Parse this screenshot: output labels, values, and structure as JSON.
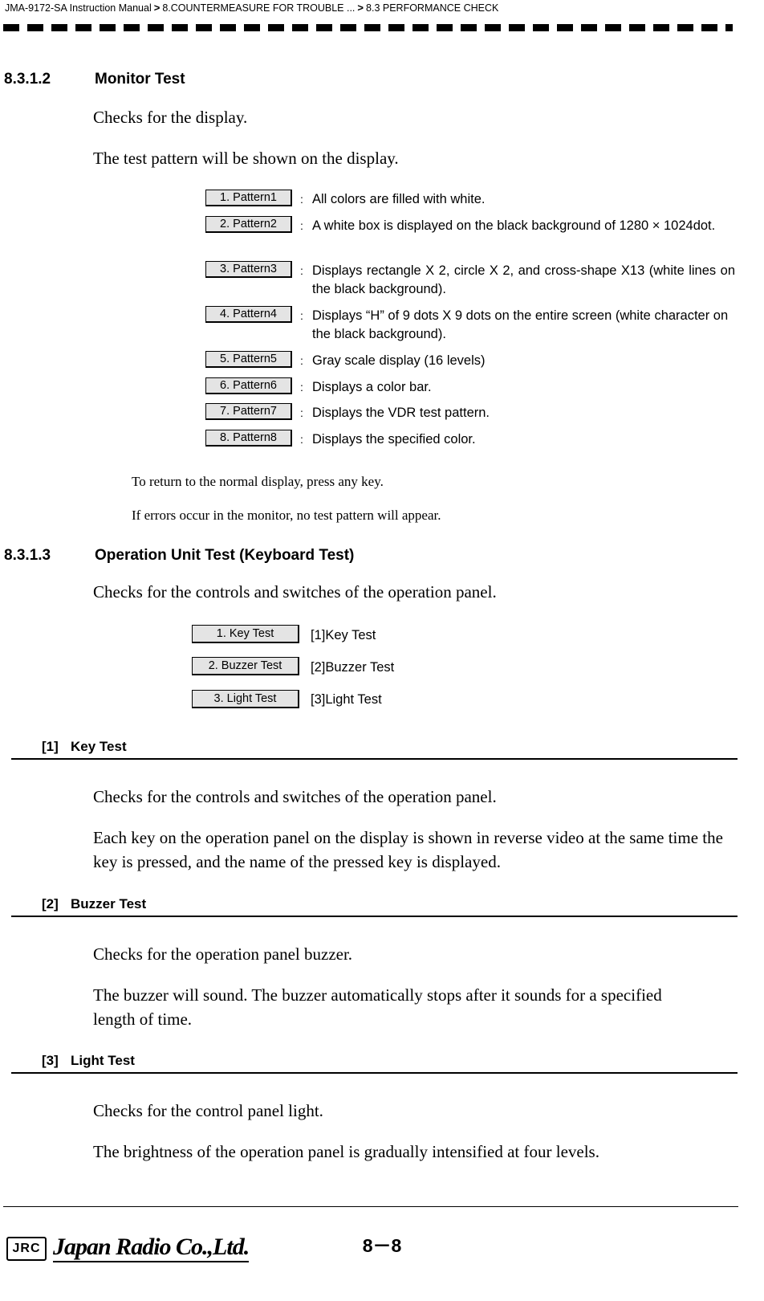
{
  "header": {
    "manual": "JMA-9172-SA Instruction Manual",
    "sep1": ">",
    "crumb1": "8.COUNTERMEASURE FOR TROUBLE ...",
    "sep2": ">",
    "crumb2": "8.3  PERFORMANCE CHECK"
  },
  "monitor_section": {
    "number": "8.3.1.2",
    "title": "Monitor Test",
    "line1": "Checks for the display.",
    "line2": "The test pattern will be shown on the display.",
    "patterns": [
      {
        "chip": "1. Pattern1",
        "colon": ":",
        "desc": "All colors are filled with white."
      },
      {
        "chip": "2. Pattern2",
        "colon": ":",
        "desc": "A white box is displayed on the black background of 1280 × 1024dot."
      },
      {
        "chip": "3. Pattern3",
        "colon": ":",
        "desc": "Displays rectangle X 2, circle X 2, and cross-shape X13 (white lines on the black background)."
      },
      {
        "chip": "4. Pattern4",
        "colon": ":",
        "desc": "Displays “H” of 9 dots X 9 dots on the entire screen (white character on the black background)."
      },
      {
        "chip": "5. Pattern5",
        "colon": ":",
        "desc": "Gray scale display (16 levels)"
      },
      {
        "chip": "6. Pattern6",
        "colon": ":",
        "desc": "Displays a color bar."
      },
      {
        "chip": "7. Pattern7",
        "colon": ":",
        "desc": "Displays the VDR test pattern."
      },
      {
        "chip": "8. Pattern8",
        "colon": ":",
        "desc": "Displays the specified color."
      }
    ],
    "note1": "To return to the normal display, press any key.",
    "note2": "If errors occur in the monitor, no test pattern will appear."
  },
  "operation_section": {
    "number": "8.3.1.3",
    "title": "Operation Unit Test  (Keyboard Test)",
    "line1": "Checks for the controls and switches of the operation panel.",
    "items": [
      {
        "chip": "1. Key Test",
        "label": "[1]Key Test"
      },
      {
        "chip": "2. Buzzer Test",
        "label": "[2]Buzzer Test"
      },
      {
        "chip": "3. Light Test",
        "label": "[3]Light Test"
      }
    ]
  },
  "subsections": [
    {
      "num": "[1]",
      "title": "Key Test",
      "para1": "Checks for the controls and switches of the operation panel.",
      "para2": "Each key on the operation panel on the display is shown in reverse video at the same time the key is pressed, and the name of the pressed key is displayed."
    },
    {
      "num": "[2]",
      "title": "Buzzer Test",
      "para1": "Checks for the operation panel buzzer.",
      "para2": "The buzzer will sound. The buzzer automatically stops after it sounds for a specified length of time."
    },
    {
      "num": "[3]",
      "title": "Light Test",
      "para1": "Checks for the control panel light.",
      "para2": "The brightness of the operation panel is gradually intensified at four levels."
    }
  ],
  "footer": {
    "logo": "JRC",
    "company_part1": "Japan Radio Co.,",
    "company_part2": "Ltd.",
    "page": "8－8"
  }
}
